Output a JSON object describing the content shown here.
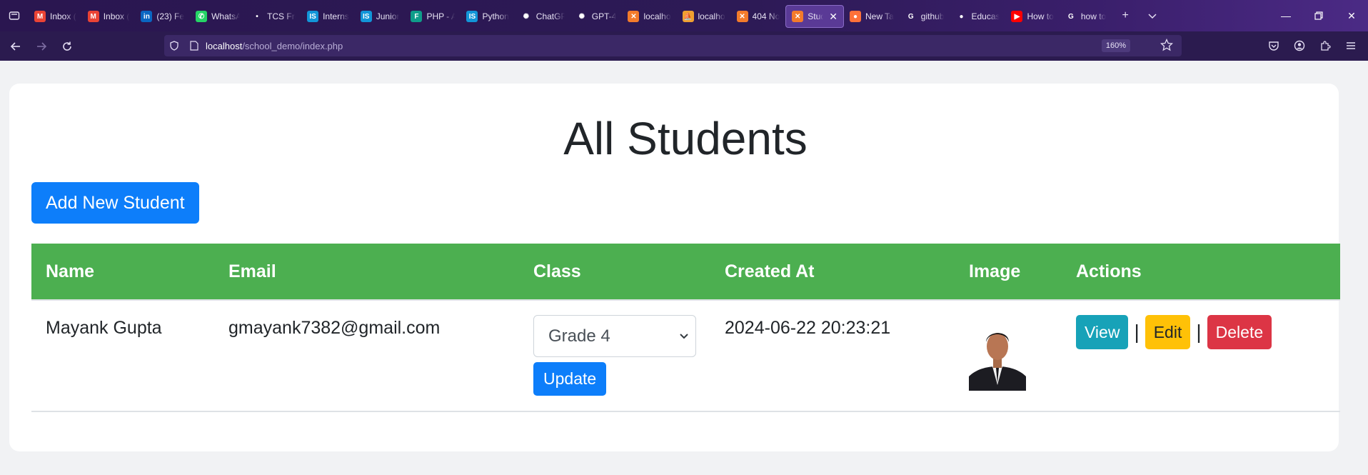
{
  "browser": {
    "tabs": [
      {
        "label": "Inbox (",
        "icon": "gmail-icon",
        "color": "#ea4335",
        "glyph": "M"
      },
      {
        "label": "Inbox (",
        "icon": "gmail-icon",
        "color": "#ea4335",
        "glyph": "M"
      },
      {
        "label": "(23) Fe",
        "icon": "linkedin-icon",
        "color": "#0a66c2",
        "glyph": "in"
      },
      {
        "label": "WhatsA",
        "icon": "whatsapp-icon",
        "color": "#25d366",
        "glyph": "✆"
      },
      {
        "label": "TCS Fre",
        "icon": "tcs-icon",
        "color": "#ffffff",
        "glyph": "•"
      },
      {
        "label": "Interns",
        "icon": "internshala-icon",
        "color": "#1295d8",
        "glyph": "IS"
      },
      {
        "label": "Junior",
        "icon": "internshala-icon",
        "color": "#1295d8",
        "glyph": "IS"
      },
      {
        "label": "PHP - A",
        "icon": "phpstorm-icon",
        "color": "#0f9d8a",
        "glyph": "F"
      },
      {
        "label": "Python",
        "icon": "internshala-icon",
        "color": "#1295d8",
        "glyph": "IS"
      },
      {
        "label": "ChatGP",
        "icon": "chatgpt-icon",
        "color": "#ffffff",
        "glyph": "✺"
      },
      {
        "label": "GPT-4",
        "icon": "chatgpt-icon",
        "color": "#222222",
        "glyph": "✺"
      },
      {
        "label": "localho",
        "icon": "xampp-icon",
        "color": "#f37b2b",
        "glyph": "✕"
      },
      {
        "label": "localho",
        "icon": "phpmyadmin-icon",
        "color": "#f0a030",
        "glyph": "⛵"
      },
      {
        "label": "404 No",
        "icon": "xampp-icon",
        "color": "#f37b2b",
        "glyph": "✕"
      },
      {
        "label": "Stud",
        "icon": "xampp-icon",
        "color": "#f37b2b",
        "glyph": "✕",
        "active": true
      },
      {
        "label": "New Ta",
        "icon": "firefox-icon",
        "color": "#ff7139",
        "glyph": "●"
      },
      {
        "label": "github",
        "icon": "google-icon",
        "color": "#ffffff",
        "glyph": "G"
      },
      {
        "label": "Educas",
        "icon": "github-icon",
        "color": "#ffffff",
        "glyph": "●"
      },
      {
        "label": "How to",
        "icon": "youtube-icon",
        "color": "#ff0000",
        "glyph": "▶"
      },
      {
        "label": "how to",
        "icon": "google-icon",
        "color": "#ffffff",
        "glyph": "G"
      }
    ],
    "url_host": "localhost",
    "url_path": "/school_demo/index.php",
    "zoom": "160%"
  },
  "page": {
    "title": "All Students",
    "add_button": "Add New Student",
    "table": {
      "headers": [
        "Name",
        "Email",
        "Class",
        "Created At",
        "Image",
        "Actions"
      ],
      "rows": [
        {
          "name": "Mayank Gupta",
          "email": "gmayank7382@gmail.com",
          "class_selected": "Grade 4",
          "update_label": "Update",
          "created_at": "2024-06-22 20:23:21",
          "view_label": "View",
          "edit_label": "Edit",
          "delete_label": "Delete",
          "separator": "|"
        }
      ]
    }
  },
  "colors": {
    "primary": "#0d7efa",
    "header_green": "#4caf50",
    "info": "#17a2b8",
    "warning": "#ffc107",
    "danger": "#dc3545"
  }
}
